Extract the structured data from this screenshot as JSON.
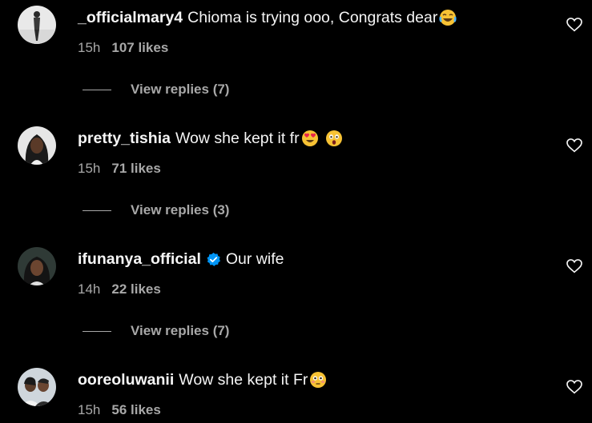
{
  "comments": [
    {
      "username": "_officialmary4",
      "text": "Chioma is trying ooo, Congrats dear",
      "emojis": [
        "laughing-tears-emoji"
      ],
      "time": "15h",
      "likes": "107 likes",
      "replies": "View replies (7)",
      "verified": false
    },
    {
      "username": "pretty_tishia",
      "text": "Wow she kept it fr",
      "emojis": [
        "heart-eyes-emoji",
        "astonished-emoji"
      ],
      "time": "15h",
      "likes": "71 likes",
      "replies": "View replies (3)",
      "verified": false
    },
    {
      "username": "ifunanya_official",
      "text": "Our wife",
      "emojis": [],
      "time": "14h",
      "likes": "22 likes",
      "replies": "View replies (7)",
      "verified": true
    },
    {
      "username": "ooreoluwanii",
      "text": "Wow she kept it Fr",
      "emojis": [
        "flushed-emoji"
      ],
      "time": "15h",
      "likes": "56 likes",
      "verified": false
    }
  ],
  "colors": {
    "background": "#000000",
    "primary_text": "#f5f5f5",
    "secondary_text": "#a8a8a8",
    "verified_blue": "#0095f6",
    "emoji_yellow": "#f7c234"
  },
  "icons": {
    "like": "heart-outline-icon",
    "verified": "verified-badge-icon"
  }
}
